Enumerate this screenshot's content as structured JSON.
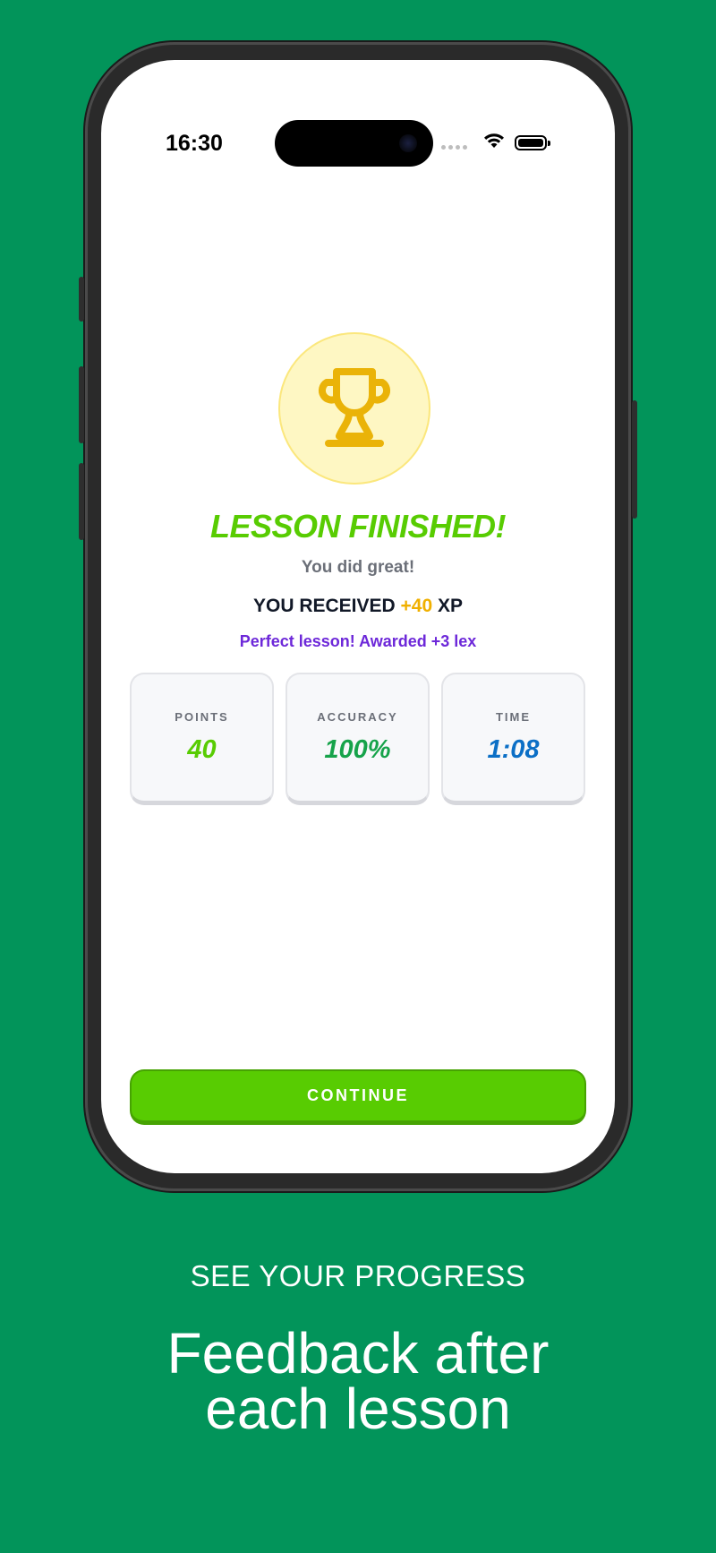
{
  "status_bar": {
    "time": "16:30"
  },
  "trophy": {
    "icon": "trophy-icon",
    "color": "#eab308"
  },
  "result": {
    "headline": "LESSON FINISHED!",
    "subline": "You did great!",
    "xp_prefix": "YOU RECEIVED",
    "xp_amount": "+40",
    "xp_suffix": "XP",
    "bonus": "Perfect lesson! Awarded +3 lex"
  },
  "stats": [
    {
      "label": "POINTS",
      "value": "40",
      "color": "#58cc02"
    },
    {
      "label": "ACCURACY",
      "value": "100%",
      "color": "#16a34a"
    },
    {
      "label": "TIME",
      "value": "1:08",
      "color": "#0b6fc6"
    }
  ],
  "continue_label": "CONTINUE",
  "promo": {
    "kicker": "SEE YOUR PROGRESS",
    "title_line1": "Feedback after",
    "title_line2": "each lesson"
  },
  "colors": {
    "background": "#02945a",
    "accent_green": "#58cc02",
    "purple": "#6d28d9",
    "gold": "#f0b000"
  }
}
